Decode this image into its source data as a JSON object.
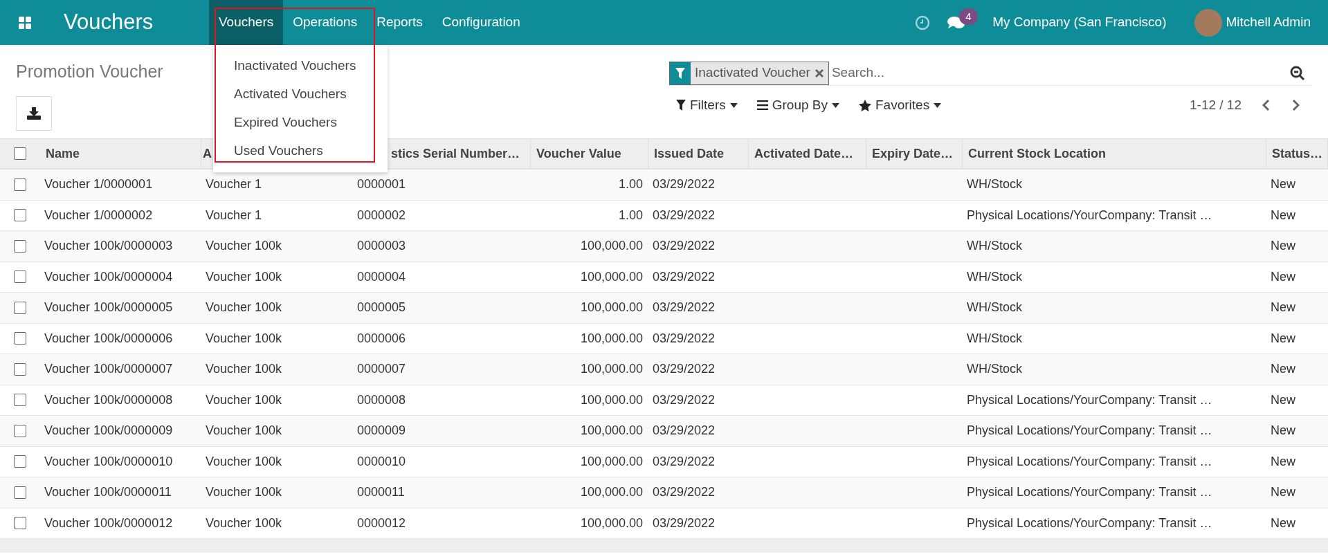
{
  "navbar": {
    "app_title": "Vouchers",
    "menu": [
      {
        "label": "Vouchers",
        "selected": true
      },
      {
        "label": "Operations",
        "selected": false
      },
      {
        "label": "Reports",
        "selected": false
      },
      {
        "label": "Configuration",
        "selected": false
      }
    ],
    "message_count": "4",
    "company": "My Company (San Francisco)",
    "user": "Mitchell Admin"
  },
  "dropdown": {
    "items": [
      "Inactivated Vouchers",
      "Activated Vouchers",
      "Expired Vouchers",
      "Used Vouchers"
    ],
    "highlighted": true
  },
  "control_panel": {
    "title": "Promotion Voucher",
    "filter_tag": "Inactivated Voucher",
    "search": {
      "placeholder": "Search..."
    },
    "filters": "Filters",
    "group_by": "Group By",
    "favorites": "Favorites",
    "pager": "1-12 / 12"
  },
  "table": {
    "all_checked": false,
    "columns": [
      {
        "label": "Name"
      },
      {
        "label": "A"
      },
      {
        "label": "stics Serial Number…"
      },
      {
        "label": "Voucher Value"
      },
      {
        "label": "Issued Date"
      },
      {
        "label": "Activated Date…"
      },
      {
        "label": "Expiry Date…"
      },
      {
        "label": "Current Stock Location"
      },
      {
        "label": "Status…"
      }
    ],
    "rows": [
      {
        "checked": false,
        "cells": [
          "Voucher 1/0000001",
          "Voucher 1",
          "0000001",
          "1.00",
          "03/29/2022",
          "",
          "",
          "WH/Stock",
          "New"
        ]
      },
      {
        "checked": false,
        "cells": [
          "Voucher 1/0000002",
          "Voucher 1",
          "0000002",
          "1.00",
          "03/29/2022",
          "",
          "",
          "Physical Locations/YourCompany: Transit …",
          "New"
        ]
      },
      {
        "checked": false,
        "cells": [
          "Voucher 100k/0000003",
          "Voucher 100k",
          "0000003",
          "100,000.00",
          "03/29/2022",
          "",
          "",
          "WH/Stock",
          "New"
        ]
      },
      {
        "checked": false,
        "cells": [
          "Voucher 100k/0000004",
          "Voucher 100k",
          "0000004",
          "100,000.00",
          "03/29/2022",
          "",
          "",
          "WH/Stock",
          "New"
        ]
      },
      {
        "checked": false,
        "cells": [
          "Voucher 100k/0000005",
          "Voucher 100k",
          "0000005",
          "100,000.00",
          "03/29/2022",
          "",
          "",
          "WH/Stock",
          "New"
        ]
      },
      {
        "checked": false,
        "cells": [
          "Voucher 100k/0000006",
          "Voucher 100k",
          "0000006",
          "100,000.00",
          "03/29/2022",
          "",
          "",
          "WH/Stock",
          "New"
        ]
      },
      {
        "checked": false,
        "cells": [
          "Voucher 100k/0000007",
          "Voucher 100k",
          "0000007",
          "100,000.00",
          "03/29/2022",
          "",
          "",
          "WH/Stock",
          "New"
        ]
      },
      {
        "checked": false,
        "cells": [
          "Voucher 100k/0000008",
          "Voucher 100k",
          "0000008",
          "100,000.00",
          "03/29/2022",
          "",
          "",
          "Physical Locations/YourCompany: Transit …",
          "New"
        ]
      },
      {
        "checked": false,
        "cells": [
          "Voucher 100k/0000009",
          "Voucher 100k",
          "0000009",
          "100,000.00",
          "03/29/2022",
          "",
          "",
          "Physical Locations/YourCompany: Transit …",
          "New"
        ]
      },
      {
        "checked": false,
        "cells": [
          "Voucher 100k/0000010",
          "Voucher 100k",
          "0000010",
          "100,000.00",
          "03/29/2022",
          "",
          "",
          "Physical Locations/YourCompany: Transit …",
          "New"
        ]
      },
      {
        "checked": false,
        "cells": [
          "Voucher 100k/0000011",
          "Voucher 100k",
          "0000011",
          "100,000.00",
          "03/29/2022",
          "",
          "",
          "Physical Locations/YourCompany: Transit …",
          "New"
        ]
      },
      {
        "checked": false,
        "cells": [
          "Voucher 100k/0000012",
          "Voucher 100k",
          "0000012",
          "100,000.00",
          "03/29/2022",
          "",
          "",
          "Physical Locations/YourCompany: Transit …",
          "New"
        ]
      }
    ]
  }
}
